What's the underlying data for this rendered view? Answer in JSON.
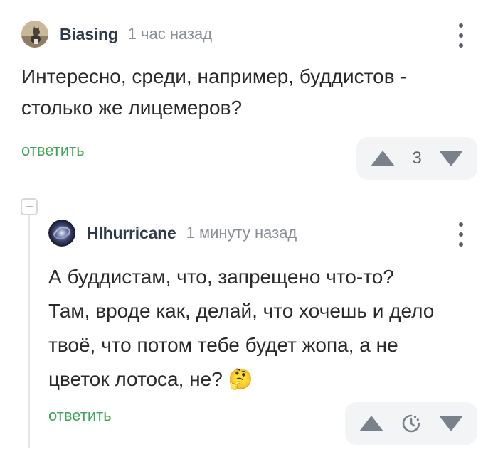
{
  "comments": [
    {
      "author": "Biasing",
      "time": "1 час назад",
      "text_lines": [
        "Интересно, среди, например, буддистов -",
        "столько же лицемеров?"
      ],
      "reply_label": "ответить",
      "score": "3",
      "avatar_icon": "cat-avatar"
    },
    {
      "author": "Hlhurricane",
      "time": "1 минуту назад",
      "text_lines": [
        "А буддистам, что, запрещено что-то?",
        "Там, вроде как, делай, что хочешь и дело",
        "твоё, что потом тебе будет жопа, а не",
        "цветок лотоса, не?"
      ],
      "reply_label": "ответить",
      "score_icon": "pending-clock-icon",
      "emoji": "🤔",
      "avatar_icon": "galaxy-avatar"
    }
  ],
  "colors": {
    "accent_green": "#3fa457",
    "vote_bg": "#f3f4f6",
    "author": "#2f3b4a",
    "muted": "#8a8f96"
  }
}
